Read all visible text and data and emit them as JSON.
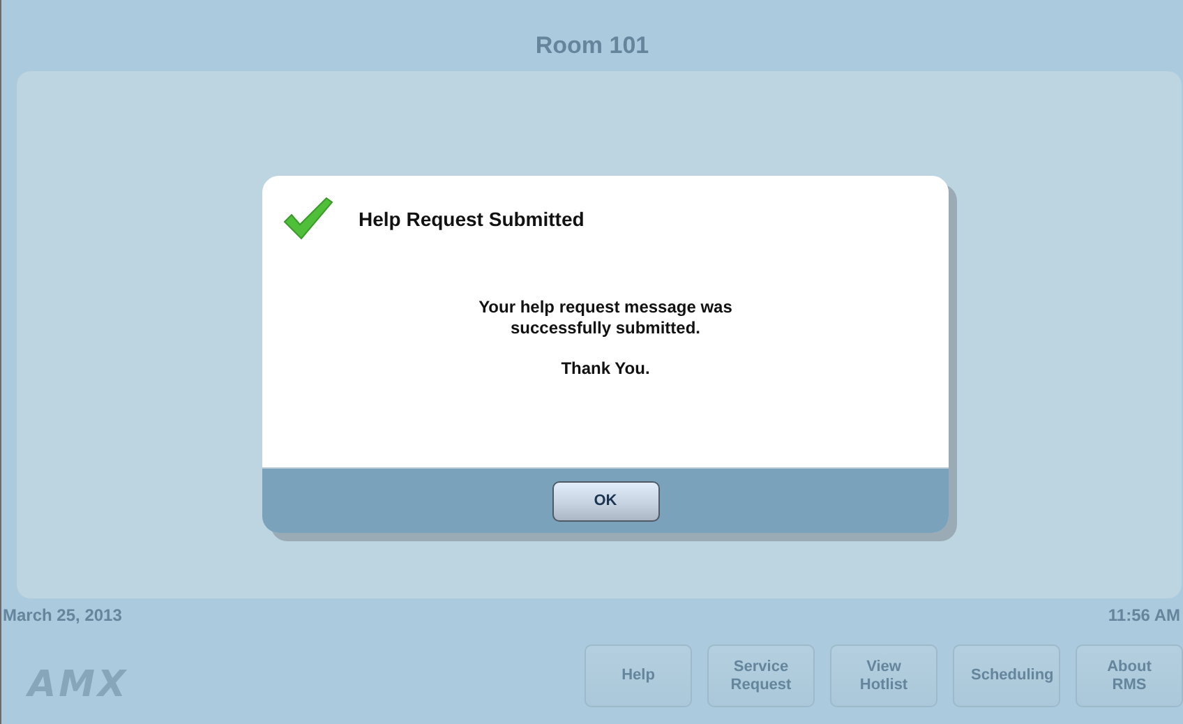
{
  "header": {
    "title": "Room 101"
  },
  "dialog": {
    "title": "Help Request Submitted",
    "message": "Your help request message was successfully submitted.",
    "thanks": "Thank You.",
    "button": "OK"
  },
  "footer": {
    "date": "March 25, 2013",
    "time": "11:56 AM",
    "logo": "AMX",
    "buttons": [
      {
        "label": "Help"
      },
      {
        "label": "Service Request"
      },
      {
        "label": "View Hotlist"
      },
      {
        "label": "Scheduling"
      },
      {
        "label": "About RMS"
      }
    ]
  }
}
